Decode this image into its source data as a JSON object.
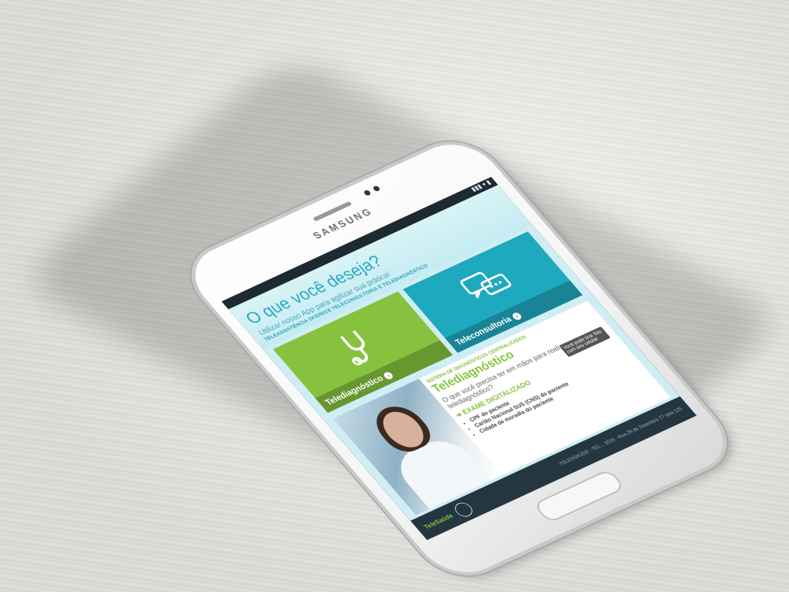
{
  "device": {
    "brand": "SAMSUNG"
  },
  "app": {
    "title": "O que você deseja?",
    "subtitle": "Utilizar nosso App para agilizar sua prática!",
    "tagline": "TELEASSISTÊNCIA OFERECE TELECONSULTORIA E TELEDIAGNÓSTICO",
    "tiles": [
      {
        "label": "Telediagnóstico",
        "icon": "stethoscope-icon"
      },
      {
        "label": "Teleconsultoria",
        "icon": "chat-bubbles-icon"
      }
    ],
    "panel": {
      "title": "Telediagnóstico",
      "kicker": "SISTEMA DE DIAGNÓSTICOS CENTRALIZADOS",
      "question": "O que você precisa ter em mãos para realizar um telediagnóstico?",
      "exam_label": "EXAME DIGITALIZADO",
      "items": [
        "CPF do paciente",
        "Cartão Nacional SUS (CNS) do paciente",
        "Cidade de moradia do paciente"
      ],
      "tip": "Você pode tirar foto com seu celular"
    },
    "footer": {
      "logo_text": "TeleSaúde",
      "address": "TELESSAÚDE - TEL... 2016 - Rua 28 de Setembro 77 sala 125"
    }
  }
}
